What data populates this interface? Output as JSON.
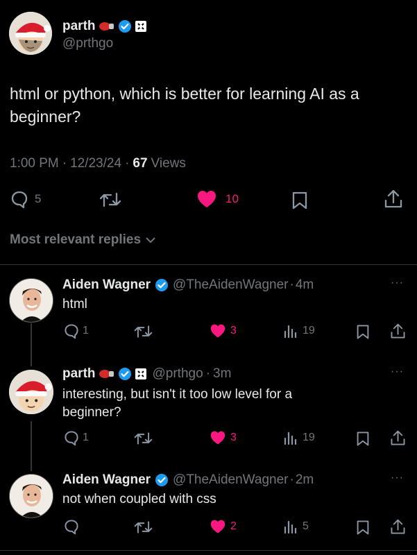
{
  "tweet": {
    "author_name": "parth",
    "author_handle": "@prthgo",
    "text": "html or python, which is better for learning AI as a beginner?",
    "time": "1:00 PM",
    "date": "12/23/24",
    "views_count": "67",
    "views_label": "Views",
    "replies": "5",
    "likes": "10"
  },
  "replies_sort": "Most relevant replies",
  "replies": [
    {
      "name": "Aiden Wagner",
      "handle": "@TheAidenWagner",
      "age": "4m",
      "text": "html",
      "replies": "1",
      "likes": "3",
      "views": "19"
    },
    {
      "name": "parth",
      "handle": "@prthgo",
      "age": "3m",
      "text_line1": "interesting, but isn't it too low level for a",
      "text_line2": "beginner?",
      "replies": "1",
      "likes": "3",
      "views": "19"
    },
    {
      "name": "Aiden Wagner",
      "handle": "@TheAidenWagner",
      "age": "2m",
      "text": "not when coupled with css",
      "likes": "2",
      "views": "5"
    }
  ],
  "colors": {
    "accent_pink": "#f91880",
    "verified_blue": "#1d9bf0",
    "muted": "#71767b"
  }
}
